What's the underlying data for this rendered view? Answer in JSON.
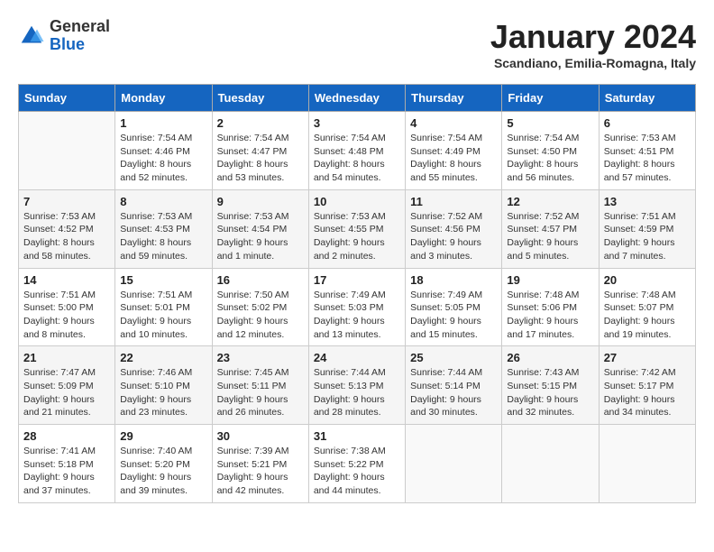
{
  "header": {
    "logo": {
      "general": "General",
      "blue": "Blue"
    },
    "title": "January 2024",
    "subtitle": "Scandiano, Emilia-Romagna, Italy"
  },
  "weekdays": [
    "Sunday",
    "Monday",
    "Tuesday",
    "Wednesday",
    "Thursday",
    "Friday",
    "Saturday"
  ],
  "weeks": [
    [
      {
        "day": "",
        "info": ""
      },
      {
        "day": "1",
        "info": "Sunrise: 7:54 AM\nSunset: 4:46 PM\nDaylight: 8 hours\nand 52 minutes."
      },
      {
        "day": "2",
        "info": "Sunrise: 7:54 AM\nSunset: 4:47 PM\nDaylight: 8 hours\nand 53 minutes."
      },
      {
        "day": "3",
        "info": "Sunrise: 7:54 AM\nSunset: 4:48 PM\nDaylight: 8 hours\nand 54 minutes."
      },
      {
        "day": "4",
        "info": "Sunrise: 7:54 AM\nSunset: 4:49 PM\nDaylight: 8 hours\nand 55 minutes."
      },
      {
        "day": "5",
        "info": "Sunrise: 7:54 AM\nSunset: 4:50 PM\nDaylight: 8 hours\nand 56 minutes."
      },
      {
        "day": "6",
        "info": "Sunrise: 7:53 AM\nSunset: 4:51 PM\nDaylight: 8 hours\nand 57 minutes."
      }
    ],
    [
      {
        "day": "7",
        "info": "Sunrise: 7:53 AM\nSunset: 4:52 PM\nDaylight: 8 hours\nand 58 minutes."
      },
      {
        "day": "8",
        "info": "Sunrise: 7:53 AM\nSunset: 4:53 PM\nDaylight: 8 hours\nand 59 minutes."
      },
      {
        "day": "9",
        "info": "Sunrise: 7:53 AM\nSunset: 4:54 PM\nDaylight: 9 hours\nand 1 minute."
      },
      {
        "day": "10",
        "info": "Sunrise: 7:53 AM\nSunset: 4:55 PM\nDaylight: 9 hours\nand 2 minutes."
      },
      {
        "day": "11",
        "info": "Sunrise: 7:52 AM\nSunset: 4:56 PM\nDaylight: 9 hours\nand 3 minutes."
      },
      {
        "day": "12",
        "info": "Sunrise: 7:52 AM\nSunset: 4:57 PM\nDaylight: 9 hours\nand 5 minutes."
      },
      {
        "day": "13",
        "info": "Sunrise: 7:51 AM\nSunset: 4:59 PM\nDaylight: 9 hours\nand 7 minutes."
      }
    ],
    [
      {
        "day": "14",
        "info": "Sunrise: 7:51 AM\nSunset: 5:00 PM\nDaylight: 9 hours\nand 8 minutes."
      },
      {
        "day": "15",
        "info": "Sunrise: 7:51 AM\nSunset: 5:01 PM\nDaylight: 9 hours\nand 10 minutes."
      },
      {
        "day": "16",
        "info": "Sunrise: 7:50 AM\nSunset: 5:02 PM\nDaylight: 9 hours\nand 12 minutes."
      },
      {
        "day": "17",
        "info": "Sunrise: 7:49 AM\nSunset: 5:03 PM\nDaylight: 9 hours\nand 13 minutes."
      },
      {
        "day": "18",
        "info": "Sunrise: 7:49 AM\nSunset: 5:05 PM\nDaylight: 9 hours\nand 15 minutes."
      },
      {
        "day": "19",
        "info": "Sunrise: 7:48 AM\nSunset: 5:06 PM\nDaylight: 9 hours\nand 17 minutes."
      },
      {
        "day": "20",
        "info": "Sunrise: 7:48 AM\nSunset: 5:07 PM\nDaylight: 9 hours\nand 19 minutes."
      }
    ],
    [
      {
        "day": "21",
        "info": "Sunrise: 7:47 AM\nSunset: 5:09 PM\nDaylight: 9 hours\nand 21 minutes."
      },
      {
        "day": "22",
        "info": "Sunrise: 7:46 AM\nSunset: 5:10 PM\nDaylight: 9 hours\nand 23 minutes."
      },
      {
        "day": "23",
        "info": "Sunrise: 7:45 AM\nSunset: 5:11 PM\nDaylight: 9 hours\nand 26 minutes."
      },
      {
        "day": "24",
        "info": "Sunrise: 7:44 AM\nSunset: 5:13 PM\nDaylight: 9 hours\nand 28 minutes."
      },
      {
        "day": "25",
        "info": "Sunrise: 7:44 AM\nSunset: 5:14 PM\nDaylight: 9 hours\nand 30 minutes."
      },
      {
        "day": "26",
        "info": "Sunrise: 7:43 AM\nSunset: 5:15 PM\nDaylight: 9 hours\nand 32 minutes."
      },
      {
        "day": "27",
        "info": "Sunrise: 7:42 AM\nSunset: 5:17 PM\nDaylight: 9 hours\nand 34 minutes."
      }
    ],
    [
      {
        "day": "28",
        "info": "Sunrise: 7:41 AM\nSunset: 5:18 PM\nDaylight: 9 hours\nand 37 minutes."
      },
      {
        "day": "29",
        "info": "Sunrise: 7:40 AM\nSunset: 5:20 PM\nDaylight: 9 hours\nand 39 minutes."
      },
      {
        "day": "30",
        "info": "Sunrise: 7:39 AM\nSunset: 5:21 PM\nDaylight: 9 hours\nand 42 minutes."
      },
      {
        "day": "31",
        "info": "Sunrise: 7:38 AM\nSunset: 5:22 PM\nDaylight: 9 hours\nand 44 minutes."
      },
      {
        "day": "",
        "info": ""
      },
      {
        "day": "",
        "info": ""
      },
      {
        "day": "",
        "info": ""
      }
    ]
  ]
}
